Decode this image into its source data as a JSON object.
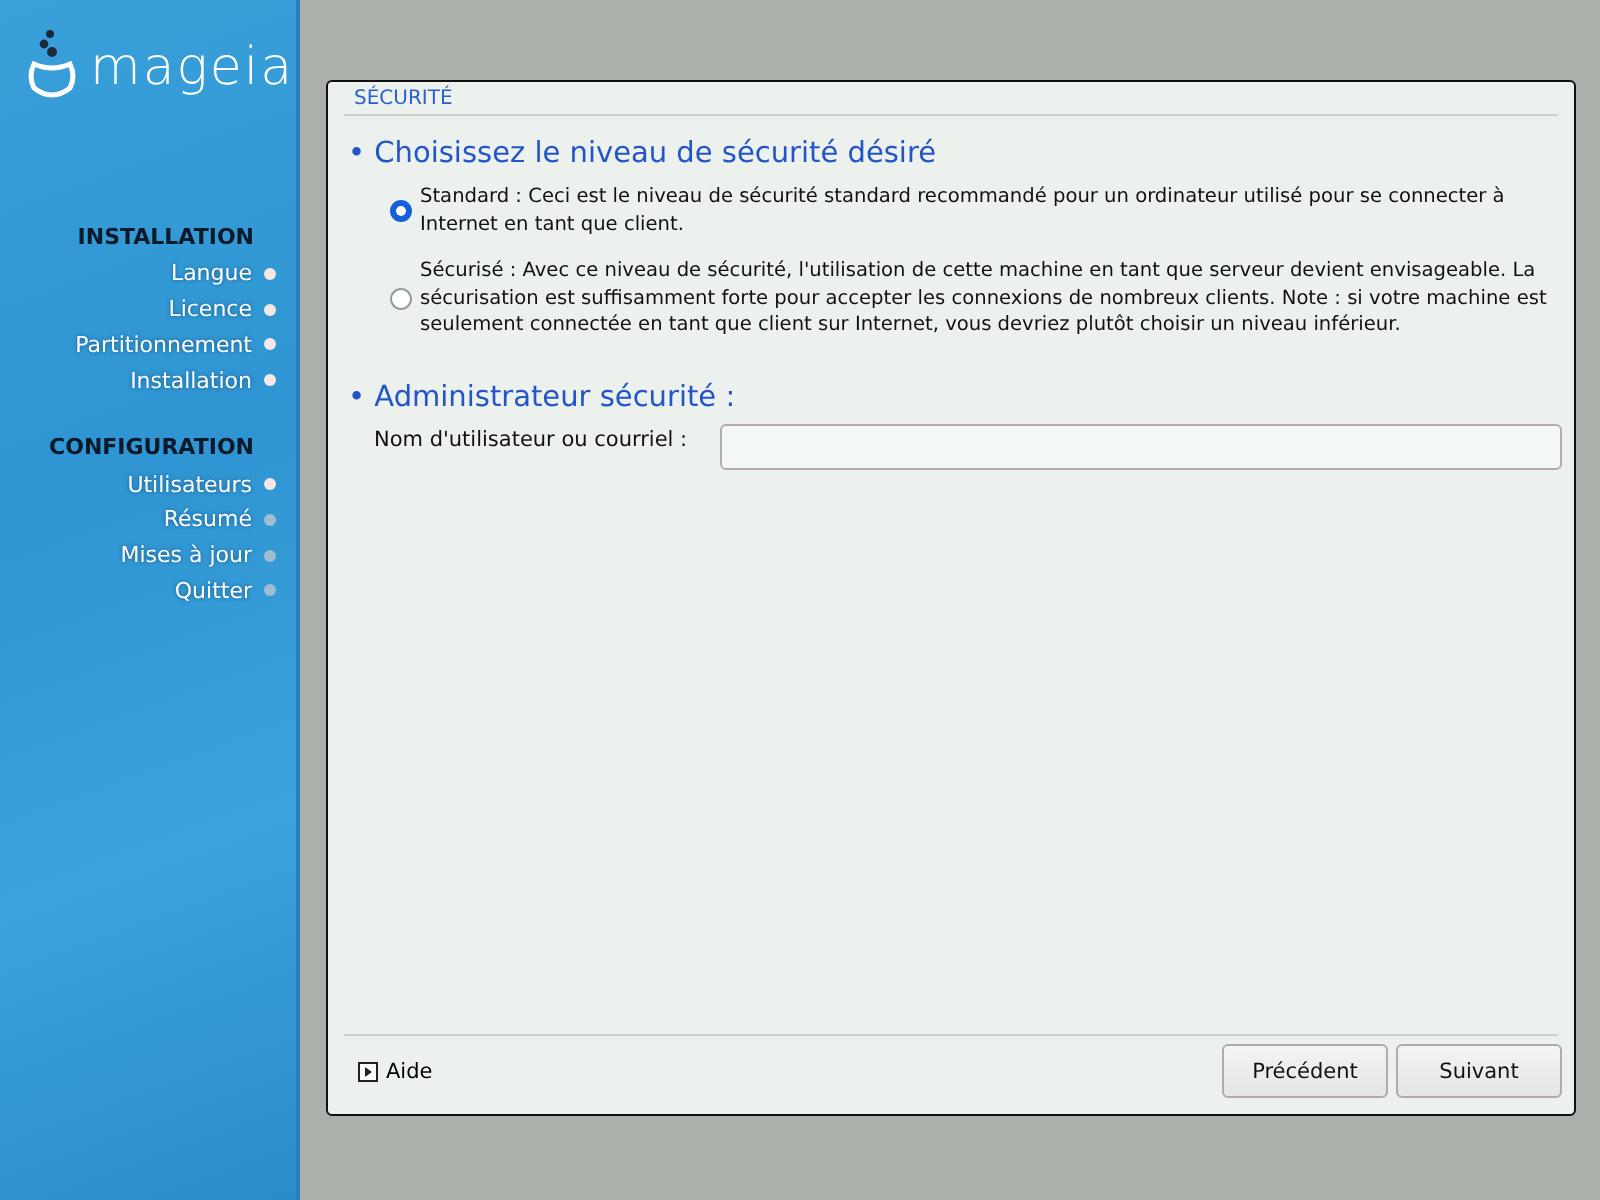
{
  "logo": {
    "text": "mageia"
  },
  "sidebar": {
    "sections": [
      {
        "title": "INSTALLATION",
        "items": [
          {
            "label": "Langue",
            "done": true
          },
          {
            "label": "Licence",
            "done": true
          },
          {
            "label": "Partitionnement",
            "done": true
          },
          {
            "label": "Installation",
            "done": true
          }
        ]
      },
      {
        "title": "CONFIGURATION",
        "items": [
          {
            "label": "Utilisateurs",
            "done": true
          },
          {
            "label": "Résumé",
            "done": false
          },
          {
            "label": "Mises à jour",
            "done": false
          },
          {
            "label": "Quitter",
            "done": false
          }
        ]
      }
    ]
  },
  "dialog": {
    "title": "SÉCURITÉ",
    "level_heading": "• Choisissez le niveau de sécurité désiré",
    "options": [
      {
        "label": "Standard : Ceci est le niveau de sécurité standard recommandé pour un ordinateur utilisé pour se connecter à Internet en tant que client.",
        "selected": true
      },
      {
        "label": "Sécurisé : Avec ce niveau de sécurité, l'utilisation de cette machine en tant que serveur devient envisageable. La sécurisation est suffisamment forte pour accepter les connexions de nombreux clients. Note : si votre machine est seulement connectée en tant que client sur Internet, vous devriez plutôt choisir un niveau inférieur.",
        "selected": false
      }
    ],
    "admin_heading": "• Administrateur sécurité :",
    "admin_field": {
      "label": "Nom d'utilisateur ou courriel :"
    },
    "help": "Aide",
    "buttons": [
      "Précédent",
      "Suivant"
    ]
  }
}
